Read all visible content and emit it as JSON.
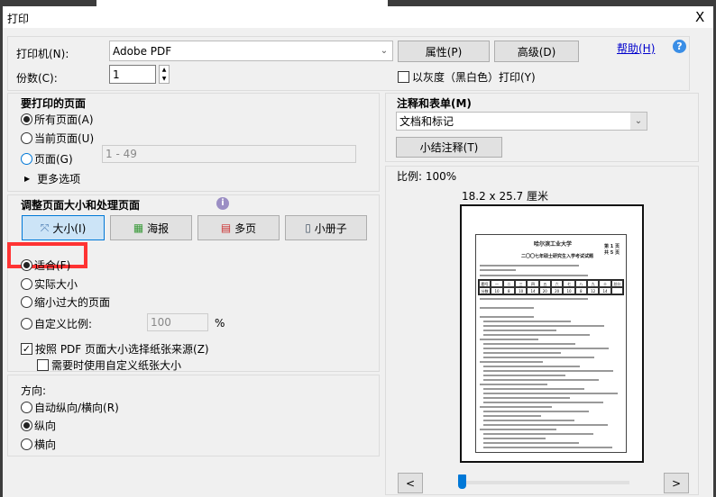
{
  "dialog": {
    "title": "打印",
    "close": "X"
  },
  "printer": {
    "label": "打印机(N):",
    "value": "Adobe PDF",
    "properties": "属性(P)",
    "advanced": "高级(D)",
    "help": "帮助(H)",
    "help_icon": "?"
  },
  "copies": {
    "label": "份数(C):",
    "value": "1",
    "grayscale": "以灰度（黑白色）打印(Y)"
  },
  "pages": {
    "title": "要打印的页面",
    "all": "所有页面(A)",
    "current": "当前页面(U)",
    "range": "页面(G)",
    "range_value": "1 - 49",
    "more": "更多选项"
  },
  "sizing": {
    "title": "调整页面大小和处理页面",
    "tabs": [
      "大小(I)",
      "海报",
      "多页",
      "小册子"
    ],
    "fit": "适合(F)",
    "actual": "实际大小",
    "shrink": "缩小过大的页面",
    "custom": "自定义比例:",
    "custom_value": "100",
    "percent": "%",
    "paper_source": "按照 PDF 页面大小选择纸张来源(Z)",
    "custom_paper": "需要时使用自定义纸张大小"
  },
  "orientation": {
    "title": "方向:",
    "auto": "自动纵向/横向(R)",
    "portrait": "纵向",
    "landscape": "横向"
  },
  "comments": {
    "title": "注释和表单(M)",
    "value": "文档和标记",
    "summarize": "小结注释(T)"
  },
  "preview": {
    "scale": "比例:  100%",
    "size": "18.2 x 25.7 厘米",
    "prev": "<",
    "next": ">",
    "page_position": 0.0,
    "doc": {
      "school": "哈尔滨工业大学",
      "page_no": "第 1 页",
      "page_total": "共 5 页",
      "exam": "二〇〇七年硕士研究生入学考试试题",
      "header_row": [
        "题号",
        "一",
        "二",
        "三",
        "四",
        "五",
        "六",
        "七",
        "八",
        "九",
        "十",
        "总分"
      ],
      "score_row": [
        "分数",
        "10",
        "8",
        "10",
        "14",
        "20",
        "20",
        "10",
        "8",
        "12",
        "14",
        ""
      ]
    }
  },
  "colors": {
    "accent": "#0078d7",
    "highlight": "#ff3333"
  }
}
